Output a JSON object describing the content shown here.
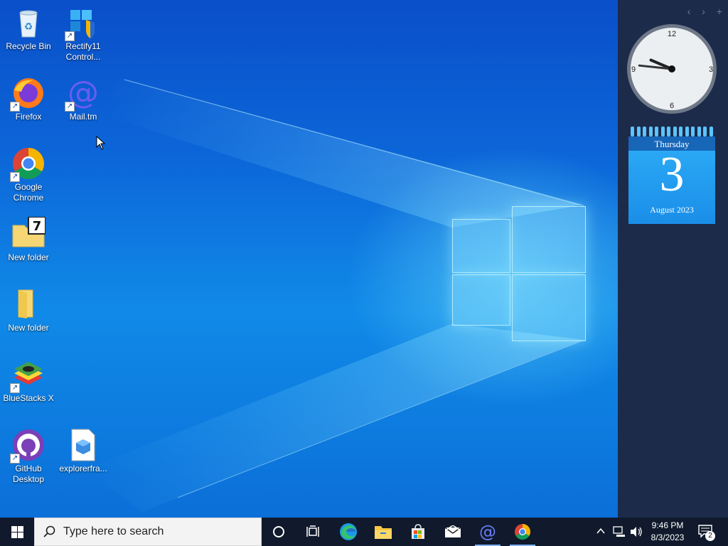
{
  "desktop": {
    "icons": [
      {
        "label": "Recycle Bin"
      },
      {
        "label": "Rectify11 Control..."
      },
      {
        "label": "Firefox"
      },
      {
        "label": "Mail.tm"
      },
      {
        "label": "Google Chrome"
      },
      {
        "label": "New folder"
      },
      {
        "label": "New folder"
      },
      {
        "label": "BlueStacks X"
      },
      {
        "label": "GitHub Desktop"
      },
      {
        "label": "explorerfra..."
      }
    ]
  },
  "sidebar": {
    "nav": [
      "‹",
      "›",
      "+"
    ],
    "clock": {
      "numerals": [
        "12",
        "3",
        "6",
        "9"
      ],
      "hour": 9,
      "minute": 46
    },
    "calendar": {
      "weekday": "Thursday",
      "day": "3",
      "month_year": "August 2023"
    }
  },
  "taskbar": {
    "search_placeholder": "Type here to search",
    "time": "9:46 PM",
    "date": "8/3/2023",
    "notification_count": "2",
    "accent": "#7fb3f5"
  }
}
